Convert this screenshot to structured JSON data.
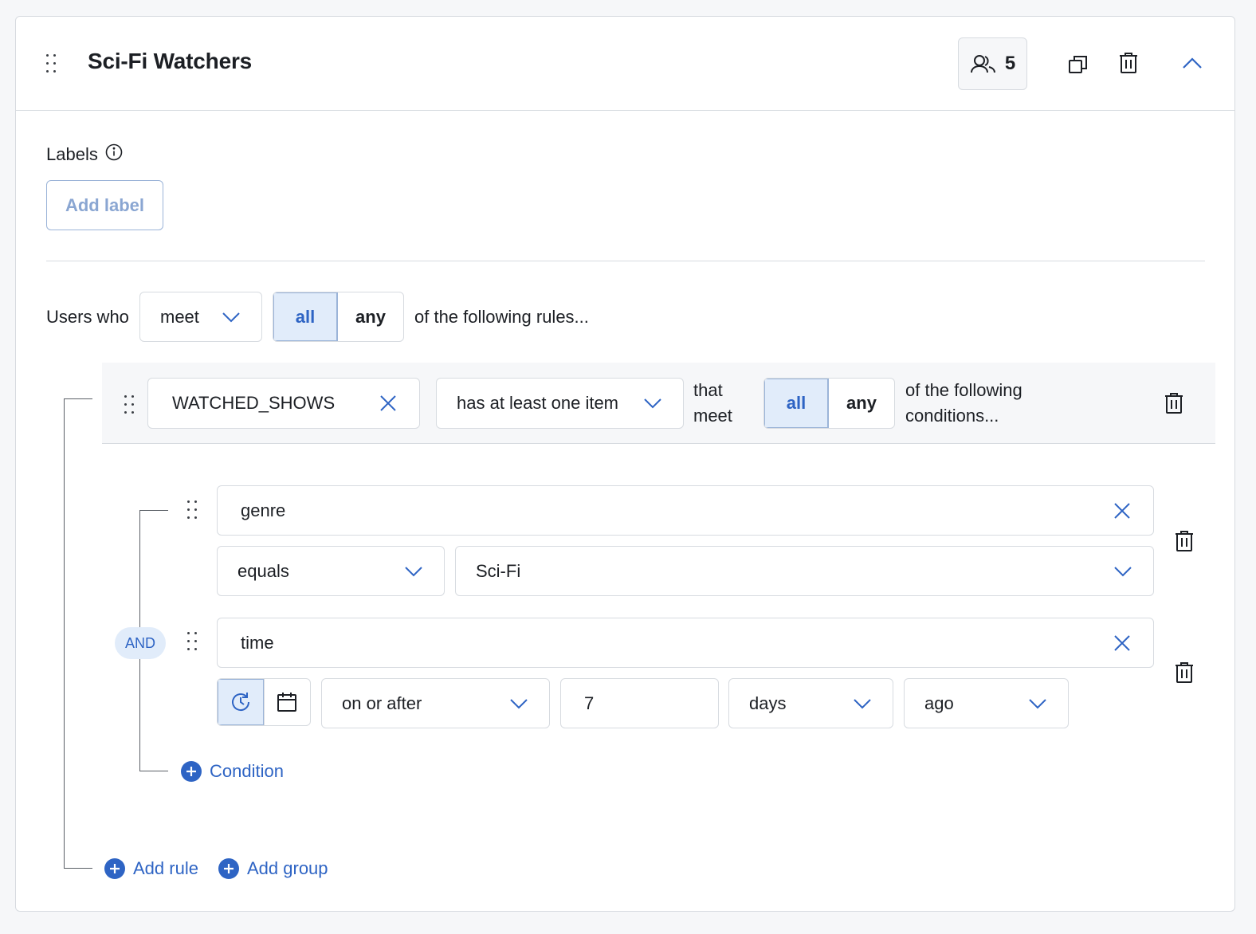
{
  "segment": {
    "title": "Sci-Fi Watchers",
    "user_count": "5"
  },
  "labels": {
    "heading": "Labels",
    "add_label": "Add label"
  },
  "rules": {
    "prefix": "Users who",
    "meet_select": "meet",
    "match_all": "all",
    "match_any": "any",
    "suffix": "of the following rules...",
    "selected_match": "all"
  },
  "rule": {
    "property": "WATCHED_SHOWS",
    "operator": "has at least one item",
    "that_meet_1": "that",
    "that_meet_2": "meet",
    "match_all": "all",
    "match_any": "any",
    "suffix_1": "of the following",
    "suffix_2": "conditions...",
    "selected_match": "all"
  },
  "conditions": [
    {
      "field": "genre",
      "operator": "equals",
      "value": "Sci-Fi"
    },
    {
      "field": "time",
      "operator": "on or after",
      "amount": "7",
      "unit": "days",
      "direction": "ago",
      "mode": "relative"
    }
  ],
  "connector": "AND",
  "actions": {
    "add_condition": "Condition",
    "add_rule": "Add rule",
    "add_group": "Add group"
  },
  "colors": {
    "accent": "#2e64c4",
    "selected_bg": "#e1ecfa",
    "border": "#d7dbe0"
  }
}
